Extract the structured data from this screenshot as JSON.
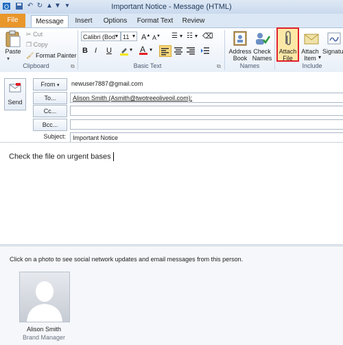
{
  "window": {
    "title": "Important Notice  -  Message (HTML)"
  },
  "tabs": {
    "file": "File",
    "message": "Message",
    "insert": "Insert",
    "options": "Options",
    "format_text": "Format Text",
    "review": "Review"
  },
  "clipboard": {
    "paste": "Paste",
    "cut": "Cut",
    "copy": "Copy",
    "format_painter": "Format Painter",
    "group_label": "Clipboard"
  },
  "basic_text": {
    "font": "Calibri (Bod",
    "size": "11",
    "bold": "B",
    "italic": "I",
    "underline": "U",
    "grow_font": "A",
    "shrink_font": "A",
    "group_label": "Basic Text"
  },
  "names": {
    "address_book_line1": "Address",
    "address_book_line2": "Book",
    "check_names_line1": "Check",
    "check_names_line2": "Names",
    "group_label": "Names"
  },
  "include": {
    "attach_file_line1": "Attach",
    "attach_file_line2": "File",
    "attach_item_line1": "Attach",
    "attach_item_line2": "Item",
    "signature": "Signatu",
    "group_label": "Include"
  },
  "compose": {
    "send_label": "Send",
    "from_label": "From",
    "from_value": "newuser7887@gmail.com",
    "to_label": "To...",
    "to_value": "Alison Smith (Asmith@twotreeoliveoil.com);",
    "cc_label": "Cc...",
    "bcc_label": "Bcc...",
    "subject_label": "Subject:",
    "subject_value": "Important Notice",
    "body_text": "Check the file on urgent bases"
  },
  "people_pane": {
    "hint": "Click on a photo to see social network updates and email messages from this person.",
    "name": "Alison Smith",
    "role": "Brand Manager"
  },
  "colors": {
    "file_tab": "#e9962b",
    "highlight_box": "#e0202a",
    "link_blue": "#1f3c88"
  }
}
